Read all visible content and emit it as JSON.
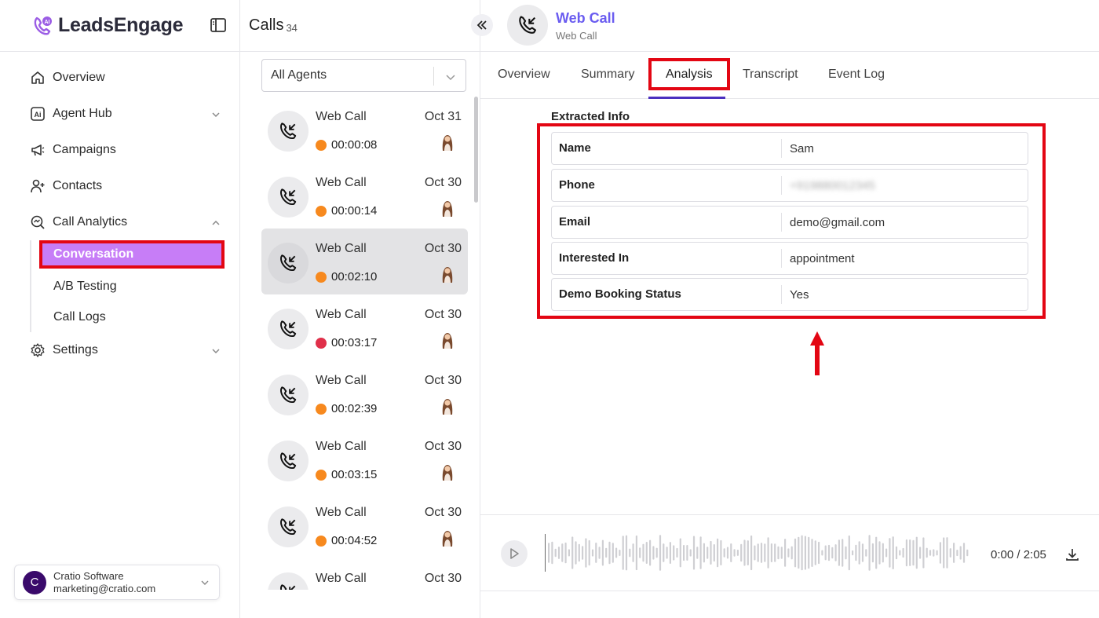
{
  "brand": {
    "name": "LeadsEngage"
  },
  "sidebar": {
    "items": [
      {
        "label": "Overview",
        "icon": "home-icon"
      },
      {
        "label": "Agent Hub",
        "icon": "ai-icon",
        "has_chevron": true
      },
      {
        "label": "Campaigns",
        "icon": "megaphone-icon"
      },
      {
        "label": "Contacts",
        "icon": "user-plus-icon"
      },
      {
        "label": "Call Analytics",
        "icon": "analytics-icon",
        "expanded": true
      }
    ],
    "sub_items": [
      {
        "label": "Conversation",
        "active": true
      },
      {
        "label": "A/B Testing"
      },
      {
        "label": "Call Logs"
      }
    ],
    "settings": {
      "label": "Settings",
      "icon": "gear-icon"
    },
    "account": {
      "initial": "C",
      "name": "Cratio Software",
      "email": "marketing@cratio.com"
    }
  },
  "calls": {
    "title": "Calls",
    "count": "34",
    "agent_filter": "All Agents",
    "items": [
      {
        "name": "Web Call",
        "date": "Oct 31",
        "duration": "00:00:08",
        "status_color": "#f7891e"
      },
      {
        "name": "Web Call",
        "date": "Oct 30",
        "duration": "00:00:14",
        "status_color": "#f7891e"
      },
      {
        "name": "Web Call",
        "date": "Oct 30",
        "duration": "00:02:10",
        "status_color": "#f7891e",
        "selected": true
      },
      {
        "name": "Web Call",
        "date": "Oct 30",
        "duration": "00:03:17",
        "status_color": "#e0304a"
      },
      {
        "name": "Web Call",
        "date": "Oct 30",
        "duration": "00:02:39",
        "status_color": "#f7891e"
      },
      {
        "name": "Web Call",
        "date": "Oct 30",
        "duration": "00:03:15",
        "status_color": "#f7891e"
      },
      {
        "name": "Web Call",
        "date": "Oct 30",
        "duration": "00:04:52",
        "status_color": "#f7891e"
      },
      {
        "name": "Web Call",
        "date": "Oct 30",
        "duration": "",
        "status_color": "#f7891e"
      }
    ]
  },
  "detail": {
    "title": "Web Call",
    "subtitle": "Web Call",
    "tabs": [
      "Overview",
      "Summary",
      "Analysis",
      "Transcript",
      "Event Log"
    ],
    "active_tab": "Analysis",
    "section_label": "Extracted Info",
    "fields": [
      {
        "key": "Name",
        "value": "Sam"
      },
      {
        "key": "Phone",
        "value": "+919880012345",
        "blurred": true
      },
      {
        "key": "Email",
        "value": "demo@gmail.com"
      },
      {
        "key": "Interested In",
        "value": "appointment"
      },
      {
        "key": "Demo Booking Status",
        "value": "Yes"
      }
    ],
    "player": {
      "time": "0:00 / 2:05"
    }
  },
  "colors": {
    "accent": "#6a5cf0",
    "active_nav": "#c77df7",
    "highlight": "#e30613",
    "tab_underline": "#4b2fbf"
  }
}
